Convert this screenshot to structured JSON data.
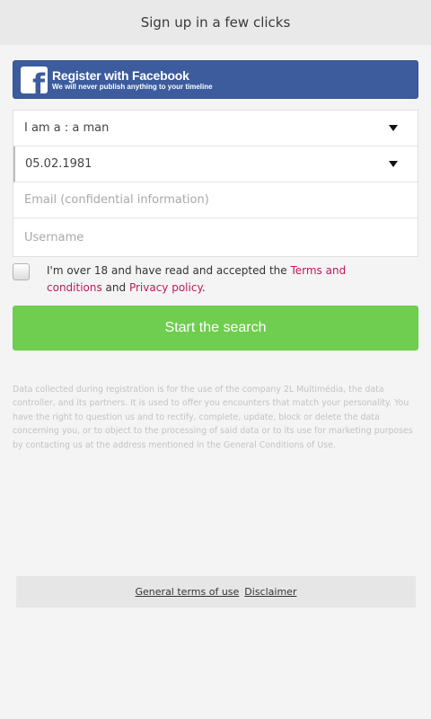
{
  "header": {
    "title": "Sign up in a few clicks"
  },
  "facebook": {
    "title": "Register with Facebook",
    "subtitle": "We will never publish anything to your timeline",
    "icon": "facebook-icon",
    "color": "#3d5c9e"
  },
  "form": {
    "gender_value": "I am a : a man",
    "birthdate_value": "05.02.1981",
    "email_placeholder": "Email (confidential information)",
    "username_placeholder": "Username"
  },
  "consent": {
    "checked": false,
    "prefix": "I'm over 18 and have read and accepted the ",
    "terms_link": "Terms and conditions",
    "middle": " and ",
    "privacy_link": "Privacy policy",
    "suffix": "."
  },
  "search_button": {
    "label": "Start the search",
    "color": "#6fcd4f"
  },
  "disclaimer": "Data collected during registration is for the use of the company 2L Multimédia, the data controller, and its partners. It is used to offer you encounters that match your personality. You have the right to question us and to rectify, complete, update, block or delete the data concerning you, or to object to the processing of said data or to its use for marketing purposes by contacting us at the address mentioned in the General Conditions of Use.",
  "footer": {
    "terms_link": "General terms of use",
    "disclaimer_link": "Disclaimer"
  },
  "colors": {
    "link": "#c2185b"
  }
}
